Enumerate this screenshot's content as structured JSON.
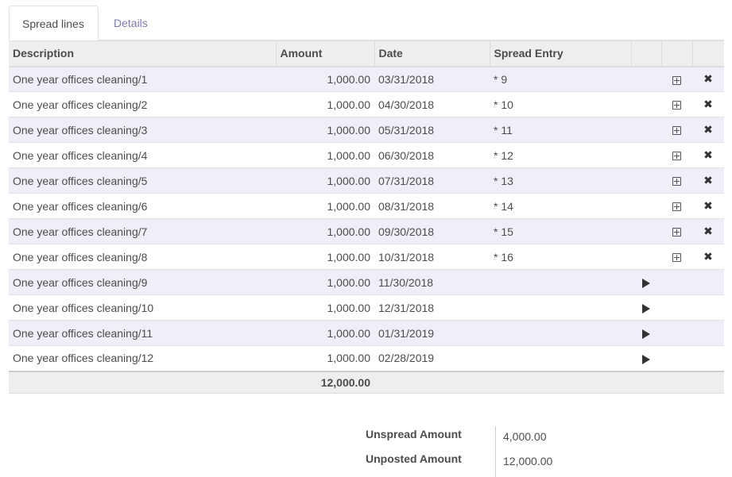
{
  "tabs": [
    {
      "label": "Spread lines",
      "active": true
    },
    {
      "label": "Details",
      "active": false
    }
  ],
  "table": {
    "headers": {
      "description": "Description",
      "amount": "Amount",
      "date": "Date",
      "spread_entry": "Spread Entry"
    },
    "rows": [
      {
        "description": "One year offices cleaning/1",
        "amount": "1,000.00",
        "date": "03/31/2018",
        "spread_entry": "* 9",
        "state": "posted"
      },
      {
        "description": "One year offices cleaning/2",
        "amount": "1,000.00",
        "date": "04/30/2018",
        "spread_entry": "* 10",
        "state": "posted"
      },
      {
        "description": "One year offices cleaning/3",
        "amount": "1,000.00",
        "date": "05/31/2018",
        "spread_entry": "* 11",
        "state": "posted"
      },
      {
        "description": "One year offices cleaning/4",
        "amount": "1,000.00",
        "date": "06/30/2018",
        "spread_entry": "* 12",
        "state": "posted"
      },
      {
        "description": "One year offices cleaning/5",
        "amount": "1,000.00",
        "date": "07/31/2018",
        "spread_entry": "* 13",
        "state": "posted"
      },
      {
        "description": "One year offices cleaning/6",
        "amount": "1,000.00",
        "date": "08/31/2018",
        "spread_entry": "* 14",
        "state": "posted"
      },
      {
        "description": "One year offices cleaning/7",
        "amount": "1,000.00",
        "date": "09/30/2018",
        "spread_entry": "* 15",
        "state": "posted"
      },
      {
        "description": "One year offices cleaning/8",
        "amount": "1,000.00",
        "date": "10/31/2018",
        "spread_entry": "* 16",
        "state": "posted"
      },
      {
        "description": "One year offices cleaning/9",
        "amount": "1,000.00",
        "date": "11/30/2018",
        "spread_entry": "",
        "state": "pending"
      },
      {
        "description": "One year offices cleaning/10",
        "amount": "1,000.00",
        "date": "12/31/2018",
        "spread_entry": "",
        "state": "pending"
      },
      {
        "description": "One year offices cleaning/11",
        "amount": "1,000.00",
        "date": "01/31/2019",
        "spread_entry": "",
        "state": "pending"
      },
      {
        "description": "One year offices cleaning/12",
        "amount": "1,000.00",
        "date": "02/28/2019",
        "spread_entry": "",
        "state": "pending"
      }
    ],
    "total_amount": "12,000.00"
  },
  "icons": {
    "open_entry": "plus-square-icon",
    "delete": "close-icon",
    "create_move": "play-icon"
  },
  "summary": {
    "unspread_label": "Unspread Amount",
    "unspread_value": "4,000.00",
    "unposted_label": "Unposted Amount",
    "unposted_value": "12,000.00"
  },
  "colors": {
    "odd_row": "#efeff8",
    "header_bg": "#eeeeee",
    "inactive_tab": "#7c7bad"
  }
}
